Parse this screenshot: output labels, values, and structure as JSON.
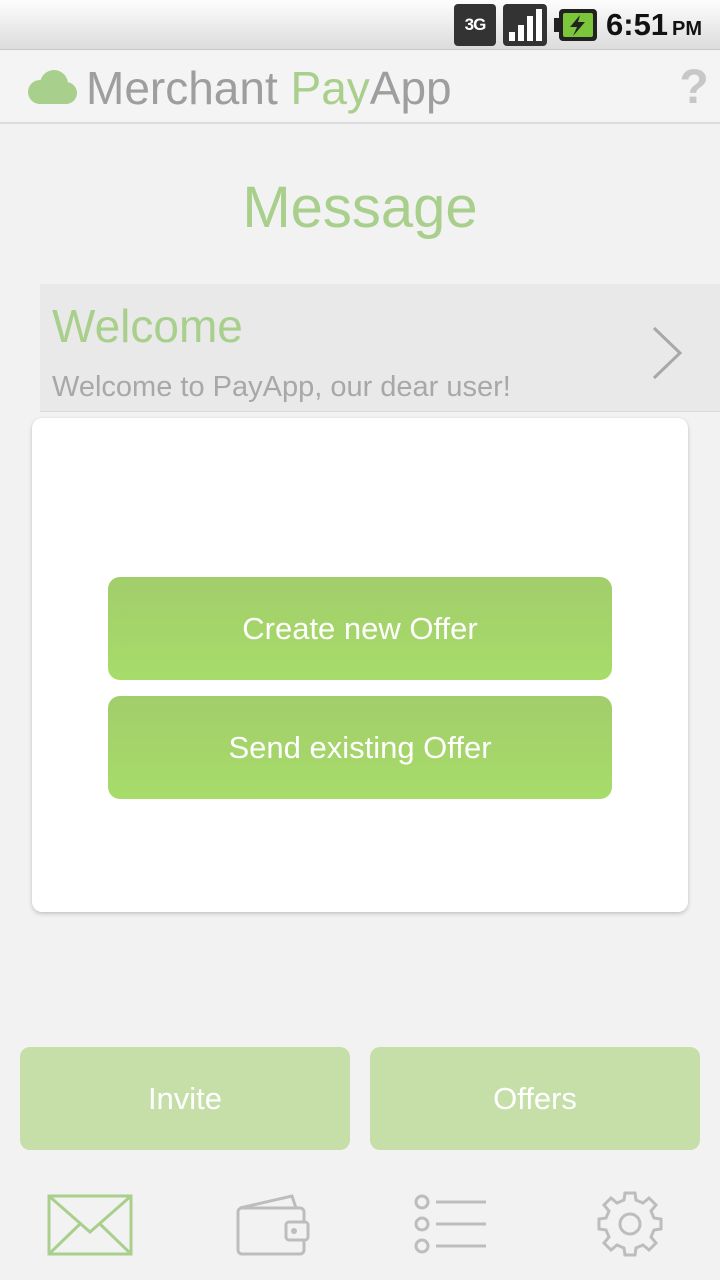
{
  "status_bar": {
    "network": "3G",
    "time": "6:51",
    "ampm": "PM"
  },
  "header": {
    "title_part1": "Merchant ",
    "title_accent": "Pay",
    "title_part2": "App",
    "help_symbol": "?"
  },
  "page": {
    "title": "Message"
  },
  "message": {
    "title": "Welcome",
    "preview": "Welcome to PayApp, our dear user!"
  },
  "popup": {
    "create_label": "Create new Offer",
    "send_label": "Send existing Offer"
  },
  "actions": {
    "invite_label": "Invite",
    "offers_label": "Offers"
  },
  "tabs": [
    {
      "icon": "envelope-icon",
      "active": true
    },
    {
      "icon": "wallet-icon",
      "active": false
    },
    {
      "icon": "list-icon",
      "active": false
    },
    {
      "icon": "gear-icon",
      "active": false
    }
  ],
  "colors": {
    "accent": "#a9cf8c",
    "button_green": "#a5d56b",
    "button_light_green": "#c6dfa9",
    "icon_gray": "#bdbdbd"
  }
}
